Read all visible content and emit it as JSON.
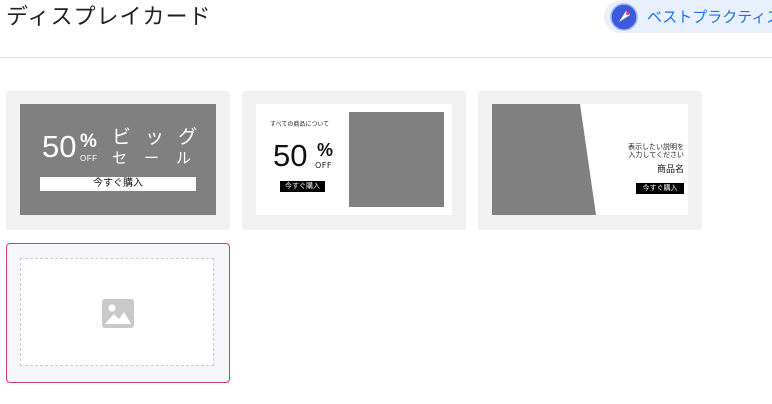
{
  "header": {
    "title": "ディスプレイカード",
    "best_practices_label": "ベストプラクティス",
    "best_practices_icon": "pen-nib-icon"
  },
  "cards": [
    {
      "template": "big-sale",
      "discount_number": "50",
      "percent_sign": "%",
      "off_label": "OFF",
      "headline": "ビッグ",
      "subline": "セール",
      "cta": "今すぐ購入",
      "background_color": "#808080"
    },
    {
      "template": "sale-with-image",
      "caption": "すべての商品について",
      "discount_number": "50",
      "percent_sign": "%",
      "off_label": "OFF",
      "cta": "今すぐ購入"
    },
    {
      "template": "product-slant",
      "description_line1": "表示したい説明を",
      "description_line2": "入力してください",
      "product_name": "商品名",
      "cta": "今すぐ購入"
    },
    {
      "template": "empty-upload",
      "icon": "image-icon",
      "selected": true
    }
  ],
  "colors": {
    "accent": "#1a73e8",
    "selected_border": "#d93b6a",
    "card_background": "#f1f1f1"
  }
}
